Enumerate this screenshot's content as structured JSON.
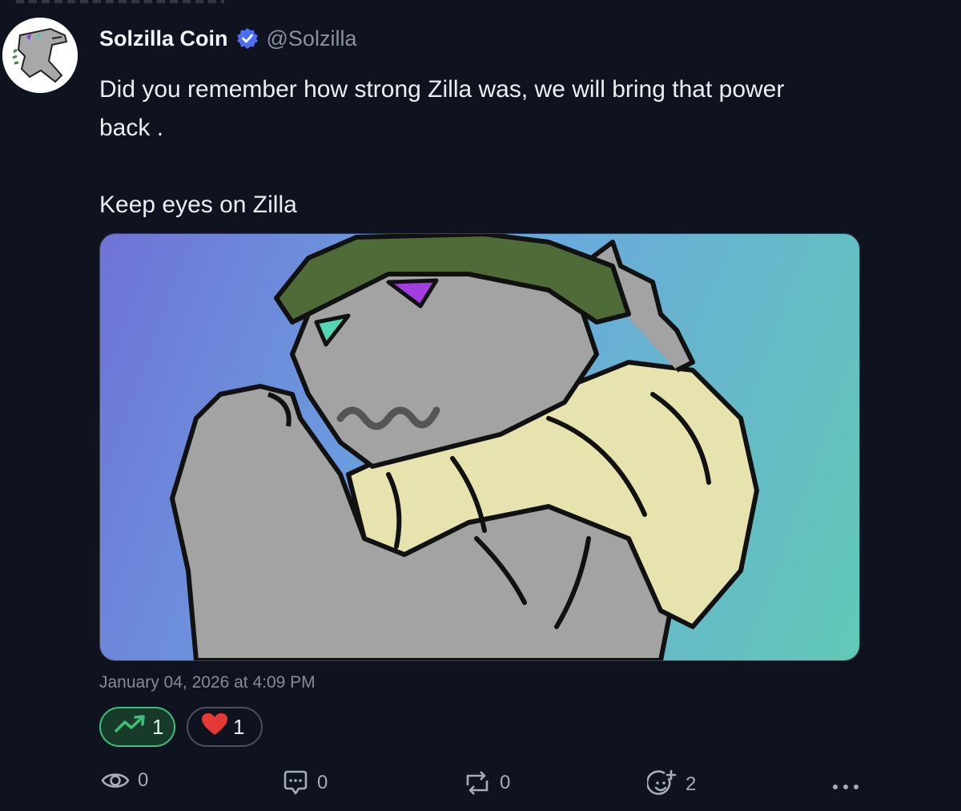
{
  "post": {
    "author_name": "Solzilla Coin",
    "author_handle": "@Solzilla",
    "verified_icon": "verified-badge-icon",
    "text": "Did you remember how strong Zilla was, we will bring that power\nback .\n\nKeep eyes on Zilla",
    "timestamp": "January 04, 2026 at 4:09 PM"
  },
  "reactions": [
    {
      "icon": "trending-up-icon",
      "count": "1",
      "color": "#3fbf7a"
    },
    {
      "icon": "heart-icon",
      "count": "1",
      "color": "#e53935"
    }
  ],
  "actions": {
    "views": {
      "icon": "eye-icon",
      "count": "0"
    },
    "replies": {
      "icon": "comment-icon",
      "count": "0"
    },
    "reposts": {
      "icon": "repost-icon",
      "count": "0"
    },
    "reacts": {
      "icon": "add-reaction-icon",
      "count": "2"
    },
    "more": {
      "icon": "more-icon"
    }
  },
  "colors": {
    "background": "#0f1320",
    "accent_green": "#3fbf7a",
    "verified_blue": "#4c6ef5"
  }
}
